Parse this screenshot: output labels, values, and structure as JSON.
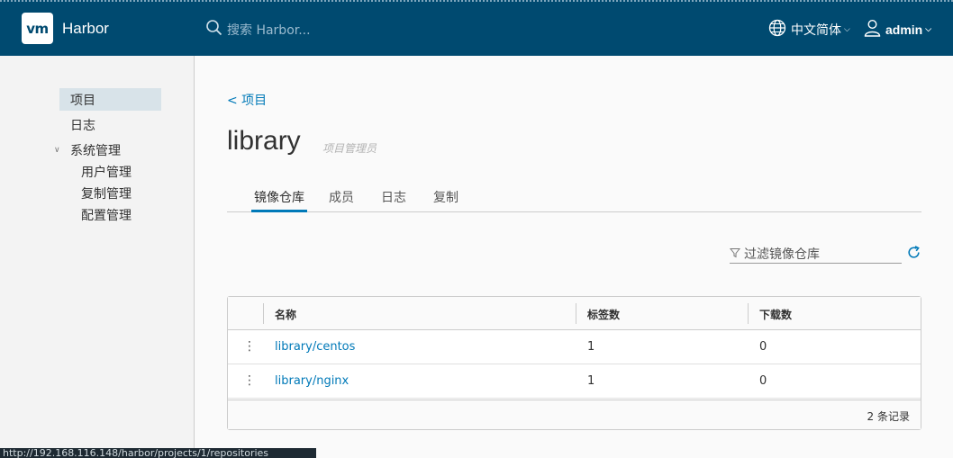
{
  "header": {
    "logo_text": "vm",
    "app_name": "Harbor",
    "search_placeholder": "搜索 Harbor...",
    "language": "中文简体",
    "user": "admin"
  },
  "sidebar": {
    "projects": "项目",
    "logs": "日志",
    "admin": "系统管理",
    "admin_items": [
      "用户管理",
      "复制管理",
      "配置管理"
    ]
  },
  "main": {
    "back_link": "< 项目",
    "title": "library",
    "role": "项目管理员",
    "tabs": [
      "镜像仓库",
      "成员",
      "日志",
      "复制"
    ],
    "filter_placeholder": "过滤镜像仓库"
  },
  "table": {
    "columns": [
      "名称",
      "标签数",
      "下载数"
    ],
    "rows": [
      {
        "name": "library/centos",
        "tags": "1",
        "pulls": "0"
      },
      {
        "name": "library/nginx",
        "tags": "1",
        "pulls": "0"
      }
    ],
    "footer": "2 条记录"
  },
  "statusbar": {
    "url": "http://192.168.116.148/harbor/projects/1/repositories"
  },
  "colors": {
    "header_bg": "#004a70",
    "accent": "#0079b8",
    "sidebar_active": "#d8e3e9"
  }
}
